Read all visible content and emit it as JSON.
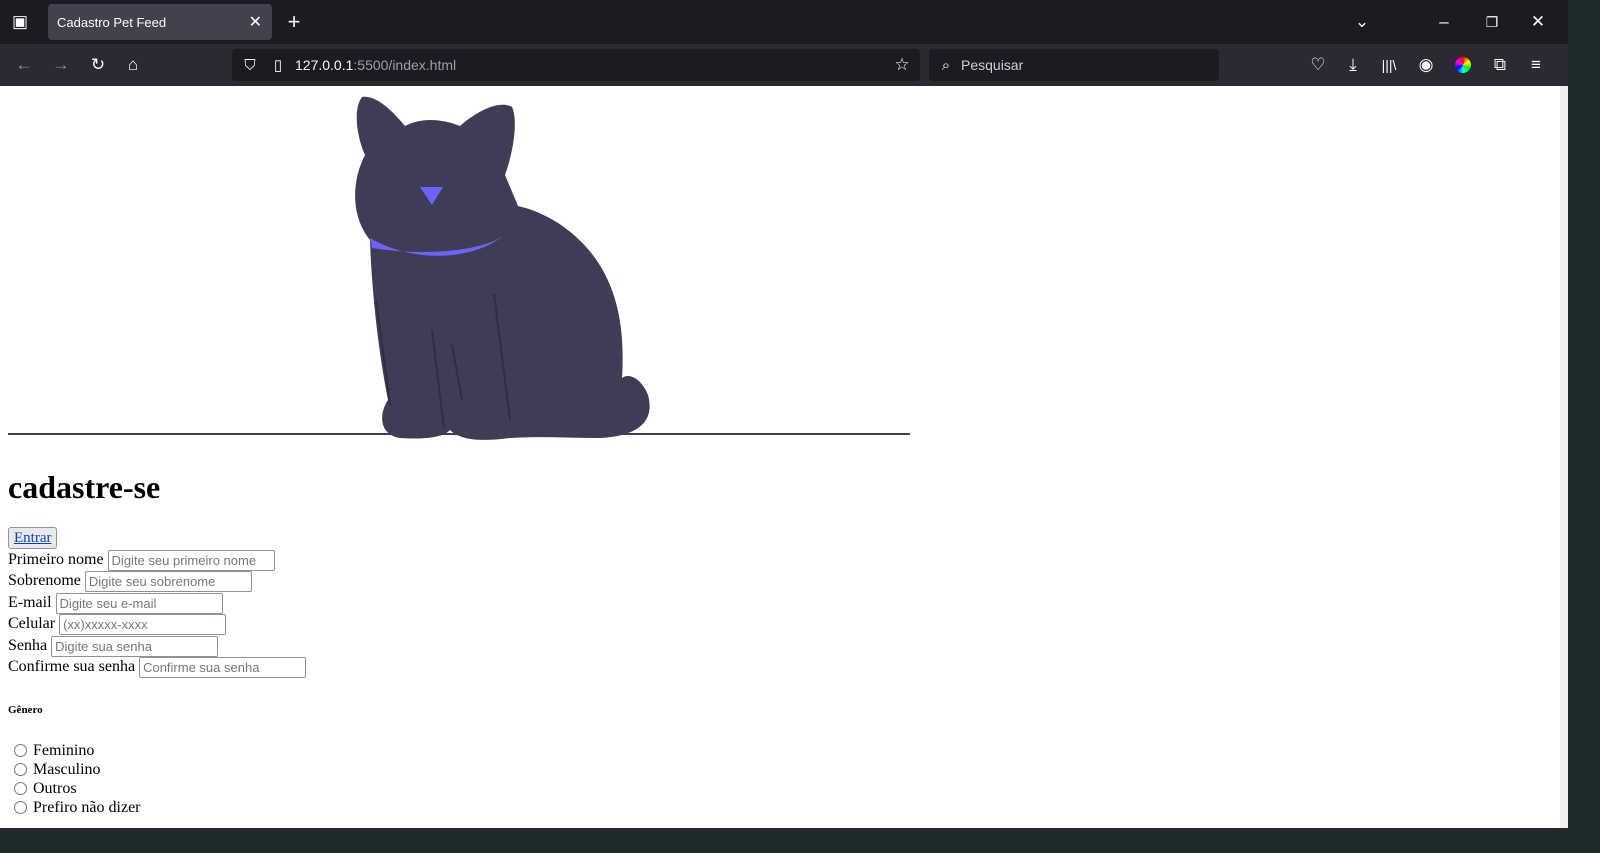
{
  "browser": {
    "tab_title": "Cadastro Pet Feed",
    "url_host": "127.0.0.1",
    "url_rest": ":5500/index.html",
    "search_placeholder": "Pesquisar"
  },
  "page": {
    "heading": "cadastre-se",
    "login_button": "Entrar",
    "fields": [
      {
        "label": "Primeiro nome",
        "placeholder": "Digite seu primeiro nome"
      },
      {
        "label": "Sobrenome",
        "placeholder": "Digite seu sobrenome"
      },
      {
        "label": "E-mail",
        "placeholder": "Digite seu e-mail"
      },
      {
        "label": "Celular",
        "placeholder": "(xx)xxxxx-xxxx"
      },
      {
        "label": "Senha",
        "placeholder": "Digite sua senha"
      },
      {
        "label": "Confirme sua senha",
        "placeholder": "Confirme sua senha"
      }
    ],
    "gender_heading": "Gênero",
    "gender_options": [
      "Feminino",
      "Masculino",
      "Outros",
      "Prefiro não dizer"
    ]
  },
  "colors": {
    "cat": "#3f3d56",
    "accent": "#6c63ff"
  }
}
